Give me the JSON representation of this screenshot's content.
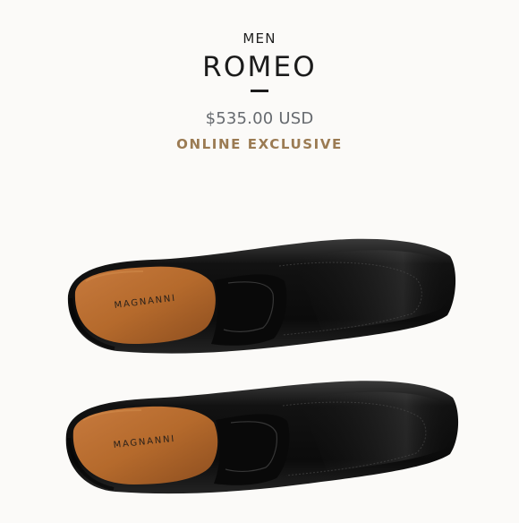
{
  "product": {
    "category": "MEN",
    "name": "ROMEO",
    "price": "$535.00 USD",
    "badge": "ONLINE EXCLUSIVE"
  },
  "image": {
    "brand_mark": "MAGNANNI"
  },
  "colors": {
    "background": "#fbfaf8",
    "title": "#1b1b1b",
    "price": "#666a6f",
    "badge": "#9b7b53",
    "leather": "#111111",
    "insole": "#b86a2c"
  }
}
